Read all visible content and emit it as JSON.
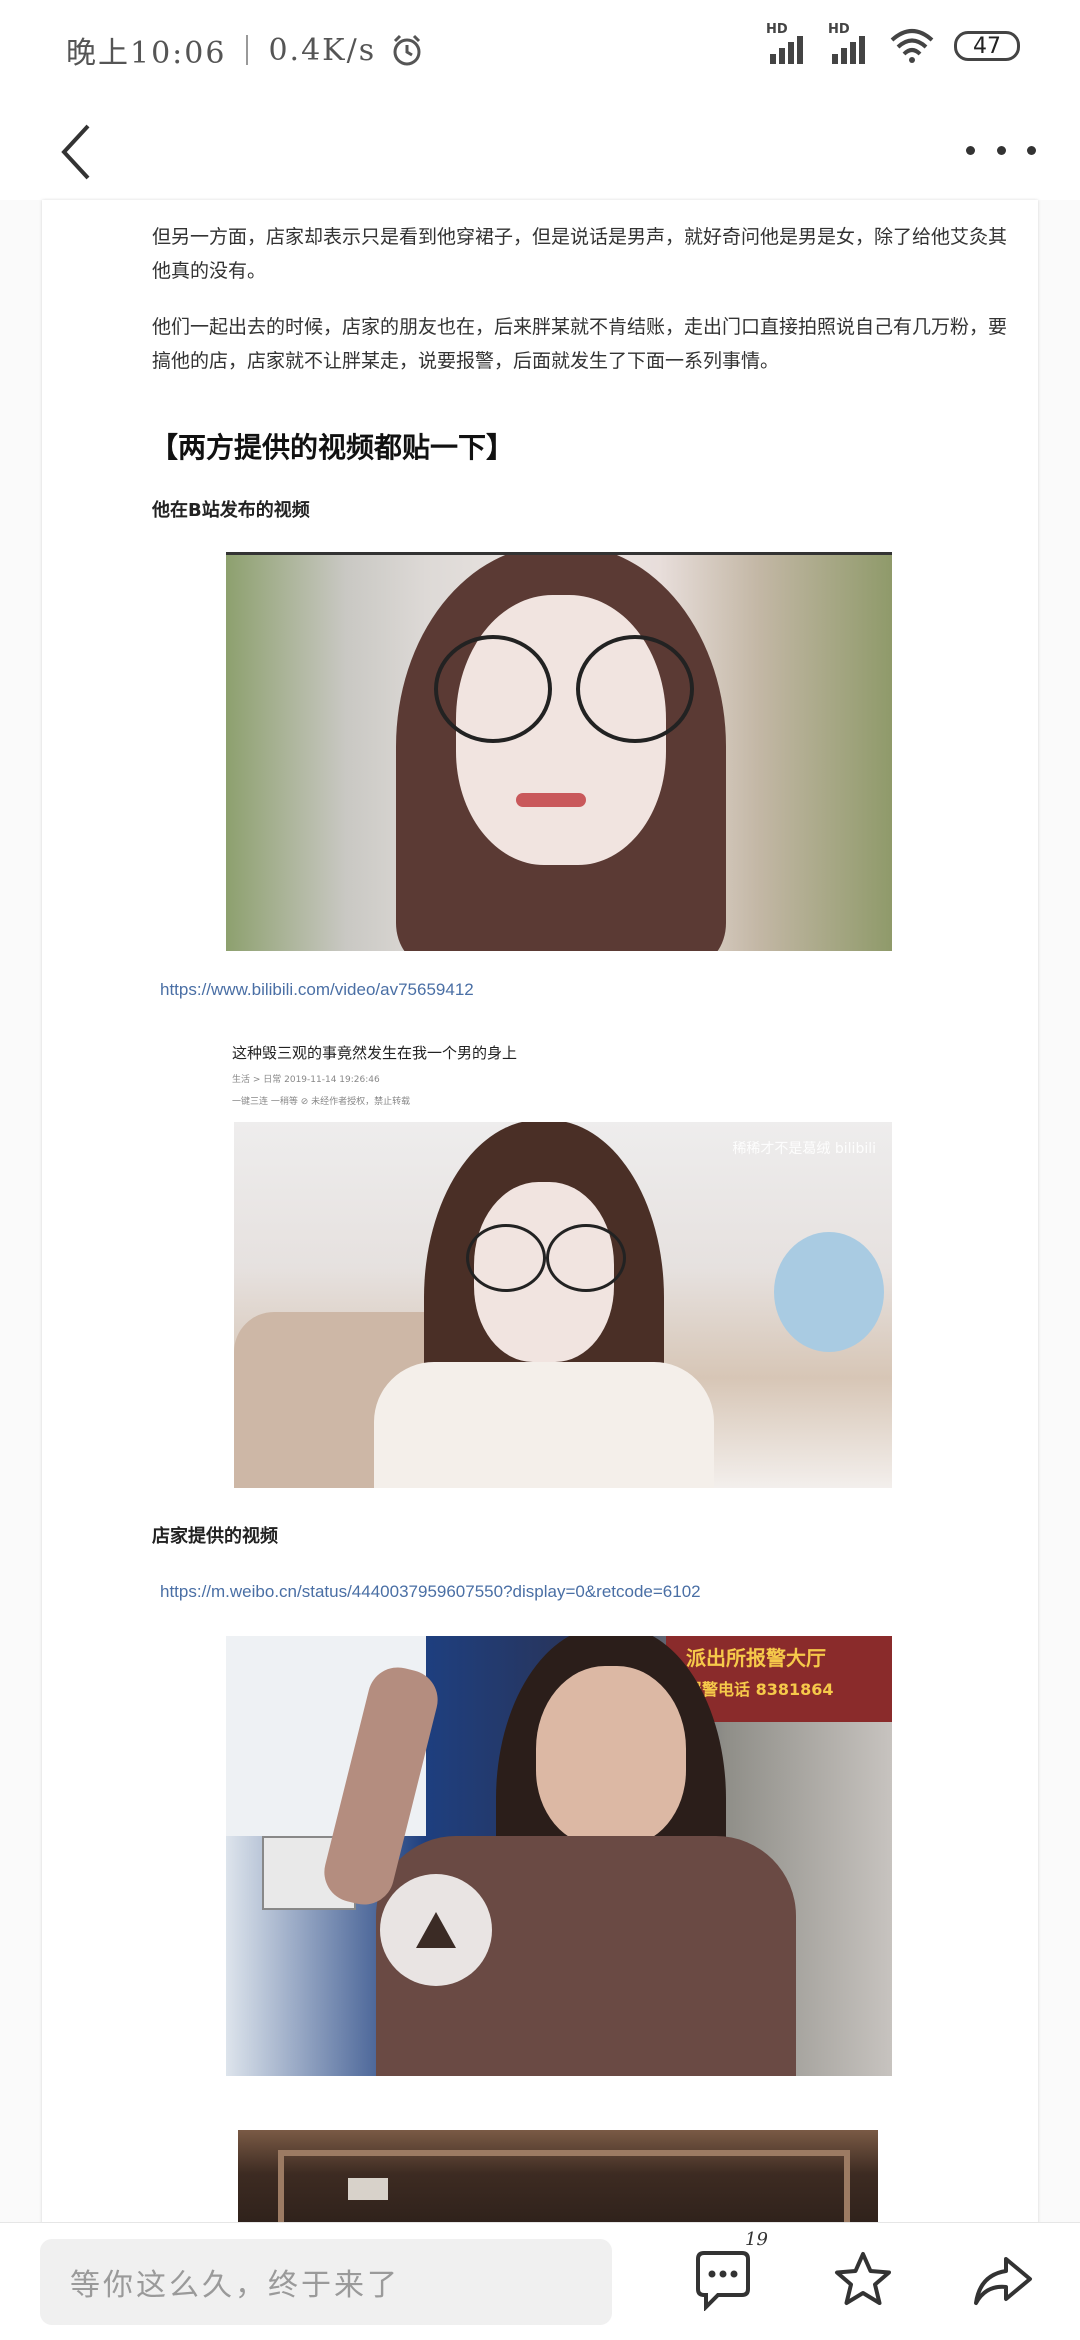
{
  "status_bar": {
    "time": "晚上10:06",
    "speed": "0.4K/s",
    "signal1_label": "HD",
    "signal2_label": "HD",
    "battery": "47"
  },
  "article": {
    "para1": "但另一方面，店家却表示只是看到他穿裙子，但是说话是男声，就好奇问他是男是女，除了给他艾灸其他真的没有。",
    "para2": "他们一起出去的时候，店家的朋友也在，后来胖某就不肯结账，走出门口直接拍照说自己有几万粉，要搞他的店，店家就不让胖某走，说要报警，后面就发生了下面一系列事情。",
    "section_title": "【两方提供的视频都贴一下】",
    "sub1": "他在B站发布的视频",
    "link1": "https://www.bilibili.com/video/av75659412",
    "video_title": "这种毁三观的事竟然发生在我一个男的身上",
    "video_meta1": "生活 > 日常    2019-11-14 19:26:46",
    "video_meta2": "一键三连  一稍等    ⊘ 未经作者授权，禁止转载",
    "watermark": "稀稀才不是葛绒  bilibili",
    "sub2": "店家提供的视频",
    "link2": "https://m.weibo.cn/status/4440037959607550?display=0&retcode=6102",
    "sign1": "派出所报警大厅",
    "sign2": "报警电话  8381864"
  },
  "bottom_bar": {
    "comment_placeholder": "等你这么久，终于来了",
    "comment_count": "19"
  },
  "colors": {
    "link": "#4a6fa5",
    "text": "#333333",
    "icon": "#333333"
  }
}
